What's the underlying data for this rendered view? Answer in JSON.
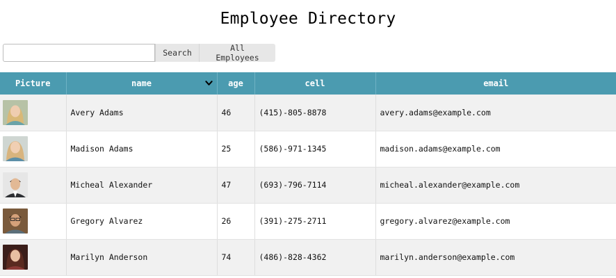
{
  "title": "Employee Directory",
  "search": {
    "value": "",
    "placeholder": "",
    "search_label": "Search",
    "all_label": "All Employees"
  },
  "table": {
    "headers": [
      "Picture",
      "name",
      "age",
      "cell",
      "email"
    ],
    "sort_icon": "chevron-down-icon",
    "rows": [
      {
        "name": "Avery Adams",
        "age": "46",
        "cell": "(415)-805-8878",
        "email": "avery.adams@example.com"
      },
      {
        "name": "Madison Adams",
        "age": "25",
        "cell": "(586)-971-1345",
        "email": "madison.adams@example.com"
      },
      {
        "name": "Micheal Alexander",
        "age": "47",
        "cell": "(693)-796-7114",
        "email": "micheal.alexander@example.com"
      },
      {
        "name": "Gregory Alvarez",
        "age": "26",
        "cell": "(391)-275-2711",
        "email": "gregory.alvarez@example.com"
      },
      {
        "name": "Marilyn Anderson",
        "age": "74",
        "cell": "(486)-828-4362",
        "email": "marilyn.anderson@example.com"
      }
    ]
  },
  "colors": {
    "header_bg": "#4b9bb0",
    "row_alt": "#f1f1f1",
    "button_bg": "#e7e7e7"
  }
}
